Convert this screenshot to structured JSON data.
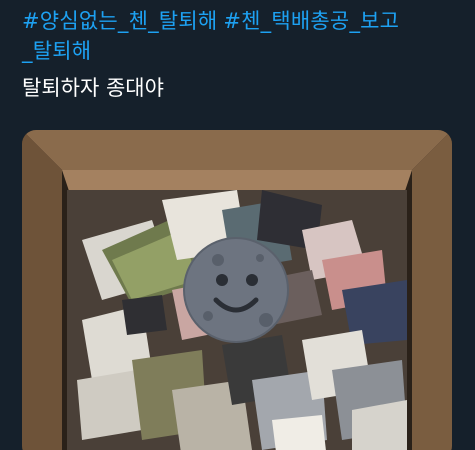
{
  "tweet": {
    "hashtags": [
      "#양심없는_첸_탈퇴해",
      "#첸_택배총공_보고",
      "_탈퇴해"
    ],
    "text": "탈퇴하자 종대야"
  },
  "media": {
    "description_icon": "moon-face-emoji-icon"
  },
  "colors": {
    "background": "#15202b",
    "hashtag": "#1da1f2",
    "text": "#ffffff"
  }
}
